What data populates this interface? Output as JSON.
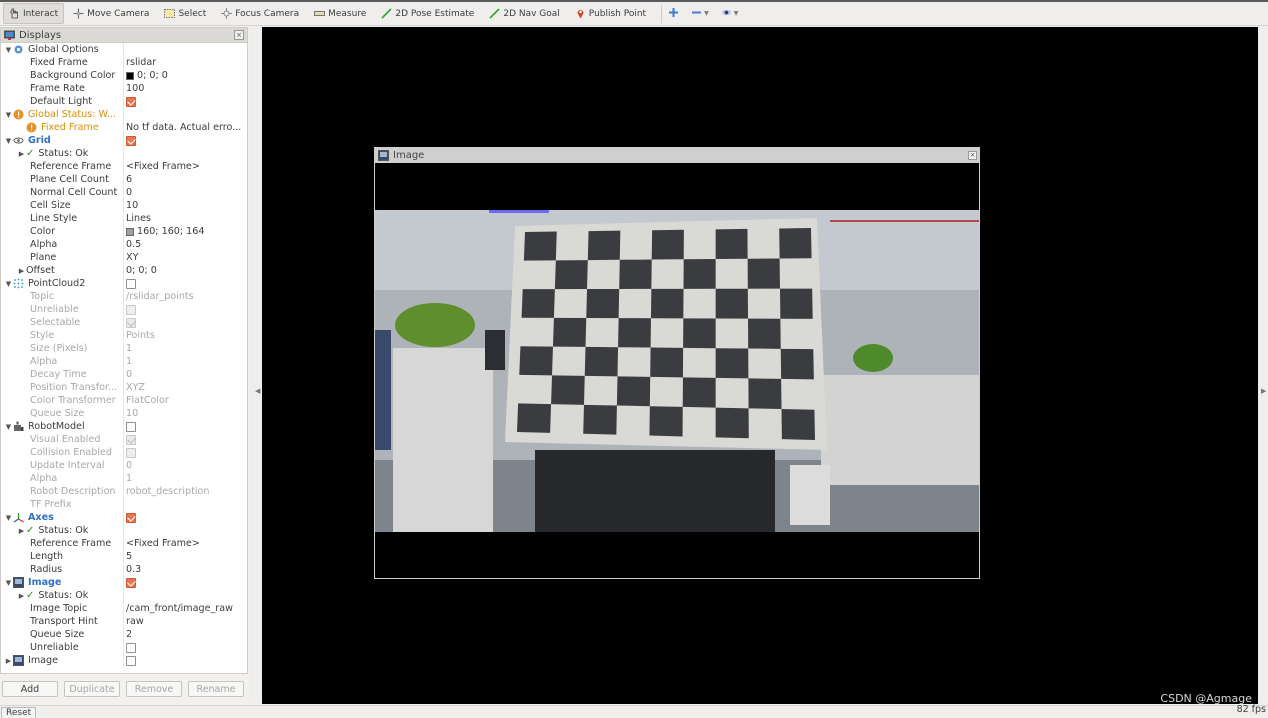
{
  "toolbar": {
    "tools": [
      {
        "label": "Interact",
        "icon": "hand-pointer-icon",
        "active": true
      },
      {
        "label": "Move Camera",
        "icon": "move-camera-icon",
        "active": false
      },
      {
        "label": "Select",
        "icon": "select-box-icon",
        "active": false
      },
      {
        "label": "Focus Camera",
        "icon": "focus-camera-icon",
        "active": false
      },
      {
        "label": "Measure",
        "icon": "ruler-icon",
        "active": false
      },
      {
        "label": "2D Pose Estimate",
        "icon": "green-arrow-icon",
        "active": false
      },
      {
        "label": "2D Nav Goal",
        "icon": "green-arrow-icon",
        "active": false
      },
      {
        "label": "Publish Point",
        "icon": "map-pin-icon",
        "active": false
      }
    ],
    "extra_icons": [
      "add-tool-icon",
      "remove-tool-icon",
      "view-options-icon"
    ]
  },
  "displays": {
    "title": "Displays",
    "rows": [
      {
        "name": "Global Options",
        "value": "",
        "level": 0,
        "arrow": "down",
        "icon": "gear-icon",
        "style": "normal"
      },
      {
        "name": "Fixed Frame",
        "value": "rslidar",
        "level": 2,
        "style": "normal"
      },
      {
        "name": "Background Color",
        "value": "0; 0; 0",
        "swatch": "#000000",
        "level": 2,
        "style": "normal"
      },
      {
        "name": "Frame Rate",
        "value": "100",
        "level": 2,
        "style": "normal"
      },
      {
        "name": "Default Light",
        "checkbox": "on",
        "level": 2,
        "style": "normal"
      },
      {
        "name": "Global Status: W...",
        "value": "",
        "level": 0,
        "arrow": "down",
        "icon": "warning-icon",
        "style": "warn"
      },
      {
        "name": "Fixed Frame",
        "value": "No tf data.  Actual erro...",
        "level": 1,
        "icon": "warning-icon",
        "style": "warn"
      },
      {
        "name": "Grid",
        "checkbox": "on",
        "level": 0,
        "arrow": "down",
        "icon": "grid-icon",
        "style": "blue"
      },
      {
        "name": "Status: Ok",
        "level": 1,
        "arrow": "right",
        "check": true,
        "style": "normal"
      },
      {
        "name": "Reference Frame",
        "value": "<Fixed Frame>",
        "level": 2,
        "style": "normal"
      },
      {
        "name": "Plane Cell Count",
        "value": "6",
        "level": 2,
        "style": "normal"
      },
      {
        "name": "Normal Cell Count",
        "value": "0",
        "level": 2,
        "style": "normal"
      },
      {
        "name": "Cell Size",
        "value": "10",
        "level": 2,
        "style": "normal"
      },
      {
        "name": "Line Style",
        "value": "Lines",
        "level": 2,
        "style": "normal"
      },
      {
        "name": "Color",
        "value": "160; 160; 164",
        "swatch": "#a0a0a4",
        "level": 2,
        "style": "normal"
      },
      {
        "name": "Alpha",
        "value": "0.5",
        "level": 2,
        "style": "normal"
      },
      {
        "name": "Plane",
        "value": "XY",
        "level": 2,
        "style": "normal"
      },
      {
        "name": "Offset",
        "value": "0; 0; 0",
        "level": 1,
        "arrow": "right",
        "style": "normal"
      },
      {
        "name": "PointCloud2",
        "checkbox": "off",
        "level": 0,
        "arrow": "down",
        "icon": "pointcloud-icon",
        "style": "normal"
      },
      {
        "name": "Topic",
        "value": "/rslidar_points",
        "level": 2,
        "style": "dis"
      },
      {
        "name": "Unreliable",
        "checkbox": "dis-off",
        "level": 2,
        "style": "dis"
      },
      {
        "name": "Selectable",
        "checkbox": "dis-on",
        "level": 2,
        "style": "dis"
      },
      {
        "name": "Style",
        "value": "Points",
        "level": 2,
        "style": "dis"
      },
      {
        "name": "Size (Pixels)",
        "value": "1",
        "level": 2,
        "style": "dis"
      },
      {
        "name": "Alpha",
        "value": "1",
        "level": 2,
        "style": "dis"
      },
      {
        "name": "Decay Time",
        "value": "0",
        "level": 2,
        "style": "dis"
      },
      {
        "name": "Position Transfor...",
        "value": "XYZ",
        "level": 2,
        "style": "dis"
      },
      {
        "name": "Color Transformer",
        "value": "FlatColor",
        "level": 2,
        "style": "dis"
      },
      {
        "name": "Queue Size",
        "value": "10",
        "level": 2,
        "style": "dis"
      },
      {
        "name": "RobotModel",
        "checkbox": "off",
        "level": 0,
        "arrow": "down",
        "icon": "robot-icon",
        "style": "normal"
      },
      {
        "name": "Visual Enabled",
        "checkbox": "dis-on",
        "level": 2,
        "style": "dis"
      },
      {
        "name": "Collision Enabled",
        "checkbox": "dis-off",
        "level": 2,
        "style": "dis"
      },
      {
        "name": "Update Interval",
        "value": "0",
        "level": 2,
        "style": "dis"
      },
      {
        "name": "Alpha",
        "value": "1",
        "level": 2,
        "style": "dis"
      },
      {
        "name": "Robot Description",
        "value": "robot_description",
        "level": 2,
        "style": "dis"
      },
      {
        "name": "TF Prefix",
        "value": "",
        "level": 2,
        "style": "dis"
      },
      {
        "name": "Axes",
        "checkbox": "on",
        "level": 0,
        "arrow": "down",
        "icon": "axes-icon",
        "style": "blue"
      },
      {
        "name": "Status: Ok",
        "level": 1,
        "arrow": "right",
        "check": true,
        "style": "normal"
      },
      {
        "name": "Reference Frame",
        "value": "<Fixed Frame>",
        "level": 2,
        "style": "normal"
      },
      {
        "name": "Length",
        "value": "5",
        "level": 2,
        "style": "normal"
      },
      {
        "name": "Radius",
        "value": "0.3",
        "level": 2,
        "style": "normal"
      },
      {
        "name": "Image",
        "checkbox": "on",
        "level": 0,
        "arrow": "down",
        "icon": "image-icon",
        "style": "blue"
      },
      {
        "name": "Status: Ok",
        "level": 1,
        "arrow": "right",
        "check": true,
        "style": "normal"
      },
      {
        "name": "Image Topic",
        "value": "/cam_front/image_raw",
        "level": 2,
        "style": "normal"
      },
      {
        "name": "Transport Hint",
        "value": "raw",
        "level": 2,
        "style": "normal"
      },
      {
        "name": "Queue Size",
        "value": "2",
        "level": 2,
        "style": "normal"
      },
      {
        "name": "Unreliable",
        "checkbox": "off",
        "level": 2,
        "style": "normal"
      },
      {
        "name": "Image",
        "checkbox": "off",
        "level": 0,
        "arrow": "right",
        "icon": "image-icon",
        "style": "normal"
      }
    ],
    "buttons": {
      "add": "Add",
      "duplicate": "Duplicate",
      "remove": "Remove",
      "rename": "Rename"
    }
  },
  "image_window": {
    "title": "Image",
    "checkerboard": {
      "rows": 7,
      "cols": 9
    }
  },
  "status": {
    "reset": "Reset",
    "fps": "82 fps"
  },
  "watermark": "CSDN @Agmage"
}
